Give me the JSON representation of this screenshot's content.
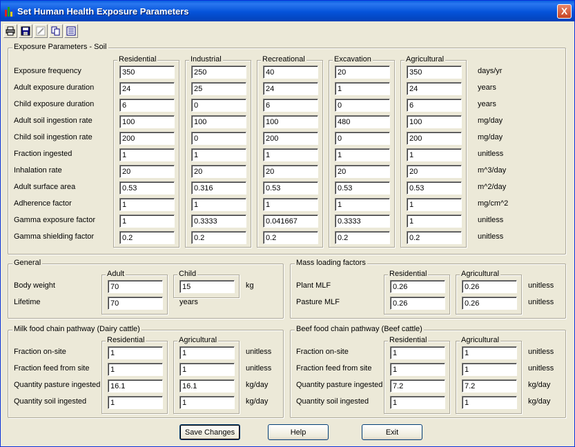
{
  "window": {
    "title": "Set Human Health Exposure Parameters",
    "close_label": "X"
  },
  "toolbar": {
    "icons": [
      "print-icon",
      "save-icon",
      "edit-icon",
      "copy-icon",
      "export-icon"
    ]
  },
  "soil": {
    "title": "Exposure Parameters - Soil",
    "columns": [
      "Residential",
      "Industrial",
      "Recreational",
      "Excavation",
      "Agricultural"
    ],
    "rows": [
      {
        "label": "Exposure frequency",
        "values": [
          "350",
          "250",
          "40",
          "20",
          "350"
        ],
        "unit": "days/yr"
      },
      {
        "label": "Adult exposure duration",
        "values": [
          "24",
          "25",
          "24",
          "1",
          "24"
        ],
        "unit": "years"
      },
      {
        "label": "Child exposure duration",
        "values": [
          "6",
          "0",
          "6",
          "0",
          "6"
        ],
        "unit": "years"
      },
      {
        "label": "Adult soil ingestion rate",
        "values": [
          "100",
          "100",
          "100",
          "480",
          "100"
        ],
        "unit": "mg/day"
      },
      {
        "label": "Child soil ingestion rate",
        "values": [
          "200",
          "0",
          "200",
          "0",
          "200"
        ],
        "unit": "mg/day"
      },
      {
        "label": "Fraction ingested",
        "values": [
          "1",
          "1",
          "1",
          "1",
          "1"
        ],
        "unit": "unitless"
      },
      {
        "label": "Inhalation rate",
        "values": [
          "20",
          "20",
          "20",
          "20",
          "20"
        ],
        "unit": "m^3/day"
      },
      {
        "label": "Adult surface area",
        "values": [
          "0.53",
          "0.316",
          "0.53",
          "0.53",
          "0.53"
        ],
        "unit": "m^2/day"
      },
      {
        "label": "Adherence factor",
        "values": [
          "1",
          "1",
          "1",
          "1",
          "1"
        ],
        "unit": "mg/cm^2"
      },
      {
        "label": "Gamma exposure factor",
        "values": [
          "1",
          "0.3333",
          "0.041667",
          "0.3333",
          "1"
        ],
        "unit": "unitless"
      },
      {
        "label": "Gamma shielding factor",
        "values": [
          "0.2",
          "0.2",
          "0.2",
          "0.2",
          "0.2"
        ],
        "unit": "unitless"
      }
    ]
  },
  "general": {
    "title": "General",
    "columns": [
      "Adult",
      "Child"
    ],
    "body_weight": {
      "label": "Body weight",
      "adult": "70",
      "child": "15",
      "unit": "kg"
    },
    "lifetime": {
      "label": "Lifetime",
      "adult": "70",
      "unit": "years"
    }
  },
  "mass": {
    "title": "Mass loading factors",
    "columns": [
      "Residential",
      "Agricultural"
    ],
    "rows": [
      {
        "label": "Plant MLF",
        "values": [
          "0.26",
          "0.26"
        ],
        "unit": "unitless"
      },
      {
        "label": "Pasture MLF",
        "values": [
          "0.26",
          "0.26"
        ],
        "unit": "unitless"
      }
    ]
  },
  "milk": {
    "title": "Milk food chain pathway (Dairy cattle)",
    "columns": [
      "Residential",
      "Agricultural"
    ],
    "rows": [
      {
        "label": "Fraction on-site",
        "values": [
          "1",
          "1"
        ],
        "unit": "unitless"
      },
      {
        "label": "Fraction feed from site",
        "values": [
          "1",
          "1"
        ],
        "unit": "unitless"
      },
      {
        "label": "Quantity pasture ingested",
        "values": [
          "16.1",
          "16.1"
        ],
        "unit": "kg/day"
      },
      {
        "label": "Quantity soil ingested",
        "values": [
          "1",
          "1"
        ],
        "unit": "kg/day"
      }
    ]
  },
  "beef": {
    "title": "Beef food chain pathway (Beef cattle)",
    "columns": [
      "Residential",
      "Agricultural"
    ],
    "rows": [
      {
        "label": "Fraction on-site",
        "values": [
          "1",
          "1"
        ],
        "unit": "unitless"
      },
      {
        "label": "Fraction feed from site",
        "values": [
          "1",
          "1"
        ],
        "unit": "unitless"
      },
      {
        "label": "Quantity pasture ingested",
        "values": [
          "7.2",
          "7.2"
        ],
        "unit": "kg/day"
      },
      {
        "label": "Quantity soil ingested",
        "values": [
          "1",
          "1"
        ],
        "unit": "kg/day"
      }
    ]
  },
  "buttons": {
    "save": "Save Changes",
    "help": "Help",
    "exit": "Exit"
  }
}
